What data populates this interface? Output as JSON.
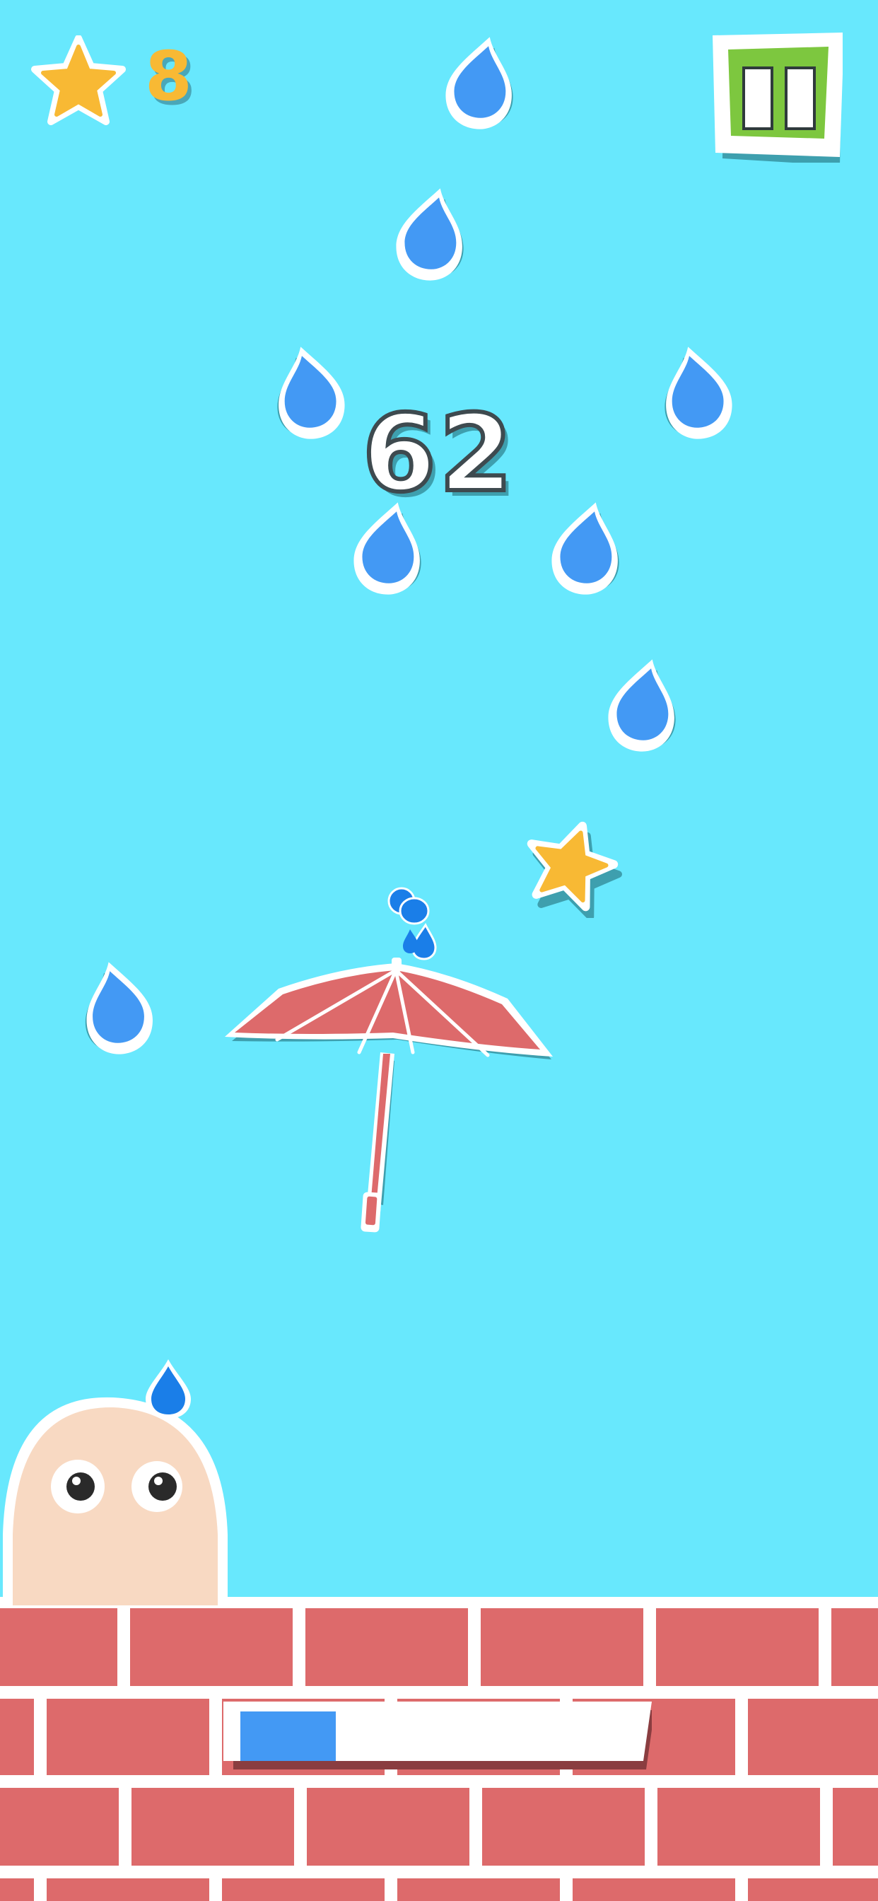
{
  "hud": {
    "stars_collected": "8",
    "score": "62",
    "pause_icon": "pause-icon",
    "star_icon": "star-icon"
  },
  "progress": {
    "fraction": 0.26
  },
  "colors": {
    "sky": "#68e8fd",
    "raindrop": "#4399f4",
    "star": "#f8b934",
    "umbrella": "#dd6a6b",
    "brick": "#dd6a6b",
    "pause_button": "#7dc73f",
    "creature": "#f8d9c2"
  }
}
